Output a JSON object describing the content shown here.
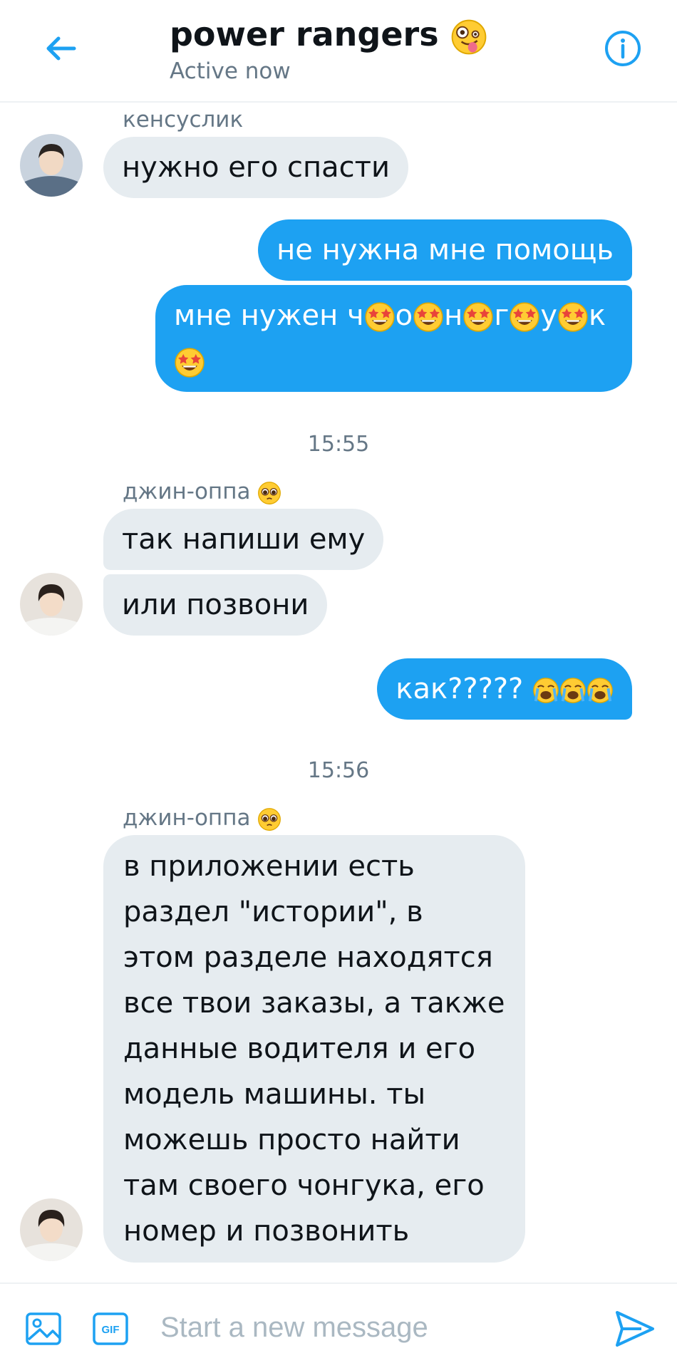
{
  "header": {
    "title": "power rangers",
    "title_emoji": "zany-face-icon",
    "status": "Active now",
    "back_icon": "back-arrow-icon",
    "info_icon": "info-icon"
  },
  "colors": {
    "accent": "#1da1f2",
    "incoming_bubble": "#e6ecf0",
    "muted_text": "#657786"
  },
  "messages": [
    {
      "sender": "кенсуслик",
      "direction": "in",
      "text": "нужно его спасти"
    },
    {
      "direction": "out",
      "text": "не нужна мне помощь"
    },
    {
      "direction": "out",
      "text": "мне нужен ч🤩о🤩н🤩г🤩у🤩к🤩",
      "emoji_icon": "star-struck-icon"
    },
    {
      "timestamp": "15:55"
    },
    {
      "sender": "джин-оппа",
      "sender_emoji": "pleading-face-icon",
      "direction": "in",
      "text": "так напиши ему"
    },
    {
      "direction": "in",
      "text": "или позвони"
    },
    {
      "direction": "out",
      "text": "как?????",
      "emoji_icon": "loudly-crying-face-icon"
    },
    {
      "timestamp": "15:56"
    },
    {
      "sender": "джин-оппа",
      "sender_emoji": "pleading-face-icon",
      "direction": "in",
      "lines": [
        "в приложении есть",
        "раздел \"истории\", в",
        "этом разделе находятся",
        "все твои заказы, а также",
        "данные водителя и его",
        "модель машины. ты",
        "можешь просто найти",
        "там своего чонгука, его",
        "номер и позвонить"
      ]
    }
  ],
  "composer": {
    "placeholder": "Start a new message",
    "gif_label": "GIF",
    "image_icon": "image-icon",
    "send_icon": "send-icon"
  }
}
